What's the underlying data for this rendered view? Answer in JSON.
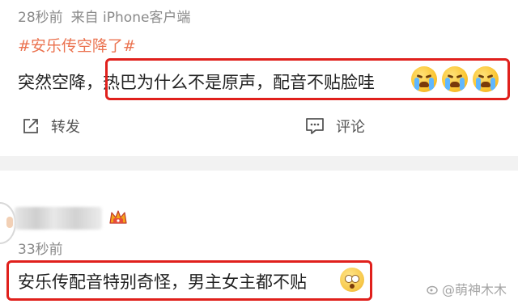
{
  "post": {
    "time": "28秒前",
    "source": "来自 iPhone客户端",
    "hashtag": "#安乐传空降了#",
    "body": "突然空降，热巴为什么不是原声，配音不贴脸哇",
    "emojis": [
      "crying-face-icon",
      "crying-face-icon",
      "crying-face-icon"
    ],
    "actions": {
      "repost_label": "转发",
      "comment_label": "评论"
    }
  },
  "comment": {
    "time": "33秒前",
    "body": "安乐传配音特别奇怪，男主女主都不贴",
    "emoji": "face-with-rolling-eyes-icon"
  },
  "watermark": {
    "text": "@萌神木木"
  },
  "colors": {
    "hashtag": "#eb7350",
    "highlight_box": "#e0201c",
    "muted_text": "#8a8a8a",
    "divider": "#f2f2f2"
  }
}
